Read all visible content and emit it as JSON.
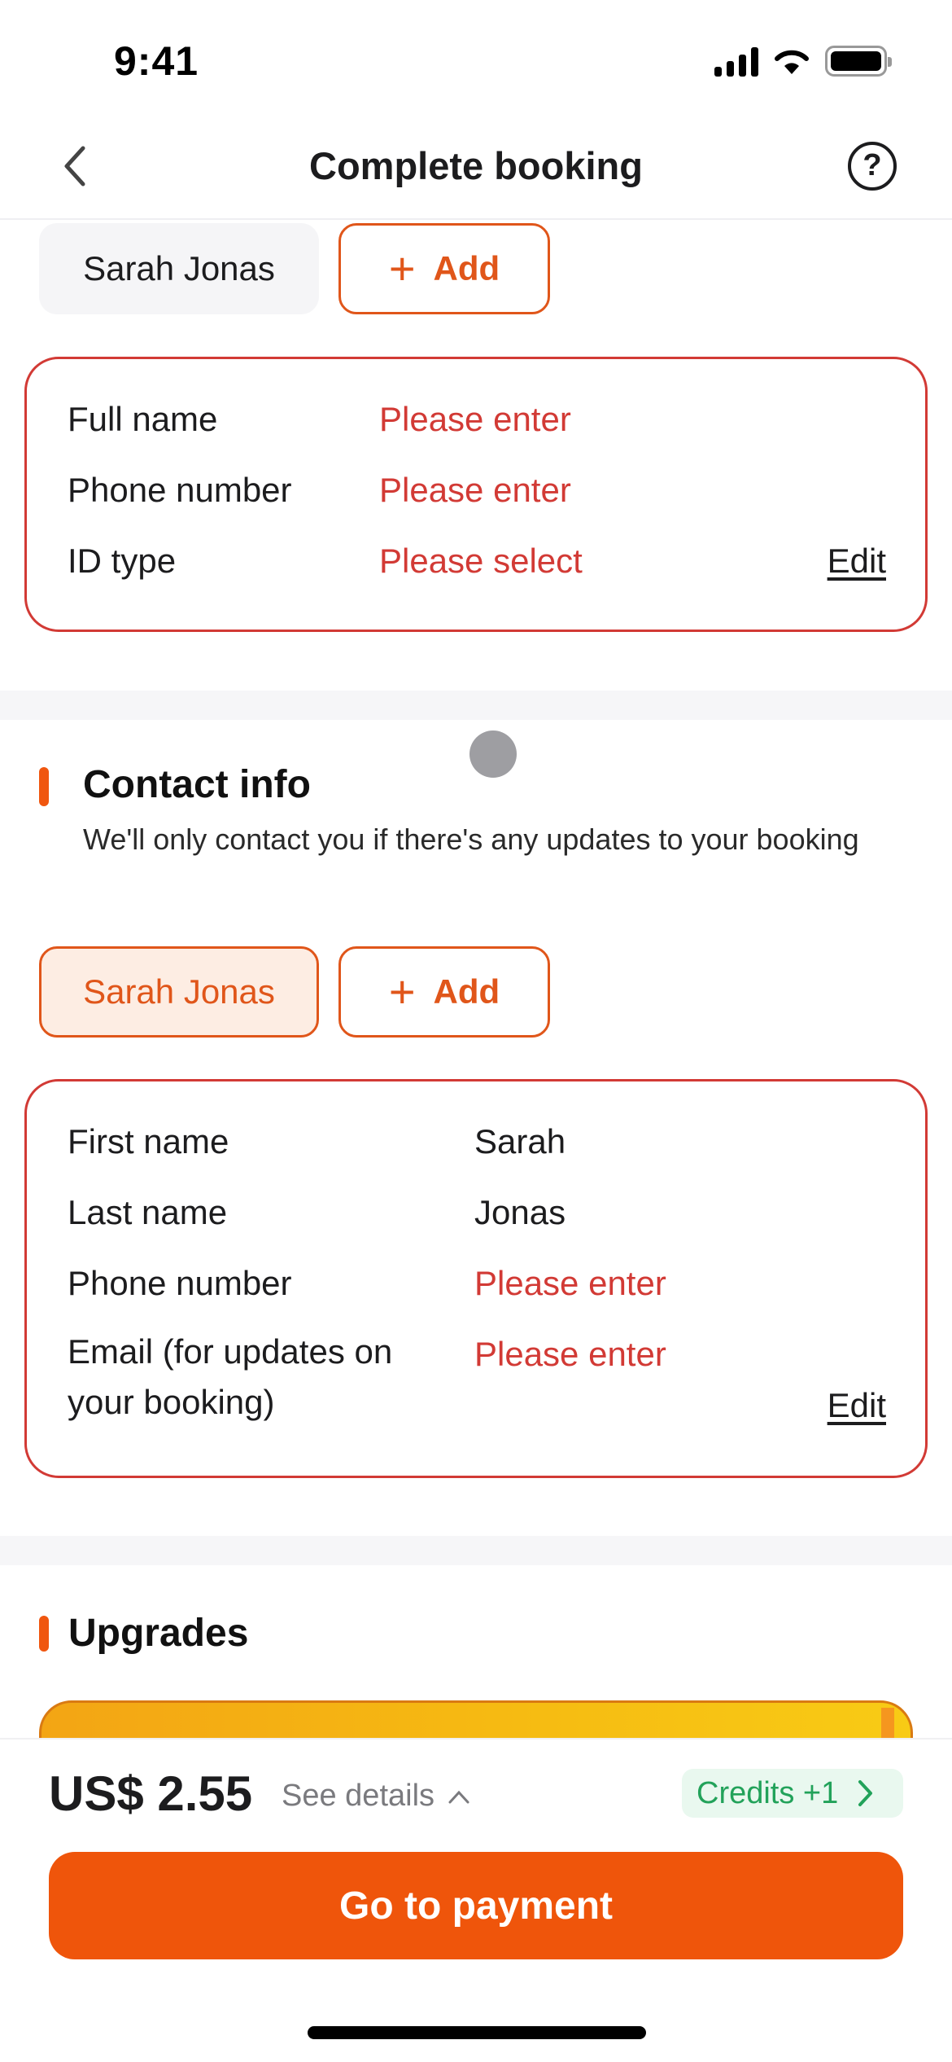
{
  "status_bar": {
    "time": "9:41"
  },
  "nav": {
    "title": "Complete booking",
    "back_icon": "chevron-left-icon",
    "help_icon": "question-circle-icon",
    "help_glyph": "?"
  },
  "traveler": {
    "chips": {
      "name": "Sarah Jonas",
      "add_plus": "+",
      "add_label": "Add"
    },
    "fields": [
      {
        "label": "Full name",
        "value": "Please enter",
        "status": "missing"
      },
      {
        "label": "Phone number",
        "value": "Please enter",
        "status": "missing"
      },
      {
        "label": "ID type",
        "value": "Please select",
        "status": "missing"
      }
    ],
    "edit_label": "Edit"
  },
  "contact": {
    "title": "Contact info",
    "subtitle": "We'll only contact you if there's any updates to your booking",
    "chips": {
      "name": "Sarah Jonas",
      "add_plus": "+",
      "add_label": "Add"
    },
    "fields": [
      {
        "label": "First name",
        "value": "Sarah",
        "status": "filled"
      },
      {
        "label": "Last name",
        "value": "Jonas",
        "status": "filled"
      },
      {
        "label": "Phone number",
        "value": "Please enter",
        "status": "missing"
      },
      {
        "label": "Email (for updates on your booking)",
        "value": "Please enter",
        "status": "missing"
      }
    ],
    "edit_label": "Edit"
  },
  "upgrades": {
    "title": "Upgrades"
  },
  "footer": {
    "price": "US$ 2.55",
    "see_details": "See details",
    "see_details_icon": "chevron-up-icon",
    "credits_label": "Credits +1",
    "credits_icon": "chevron-right-icon",
    "pay_button": "Go to payment"
  },
  "colors": {
    "accent": "#ef550b",
    "error": "#d23a35",
    "credits_green": "#22a25a",
    "selected_chip_bg": "#fdede3"
  }
}
